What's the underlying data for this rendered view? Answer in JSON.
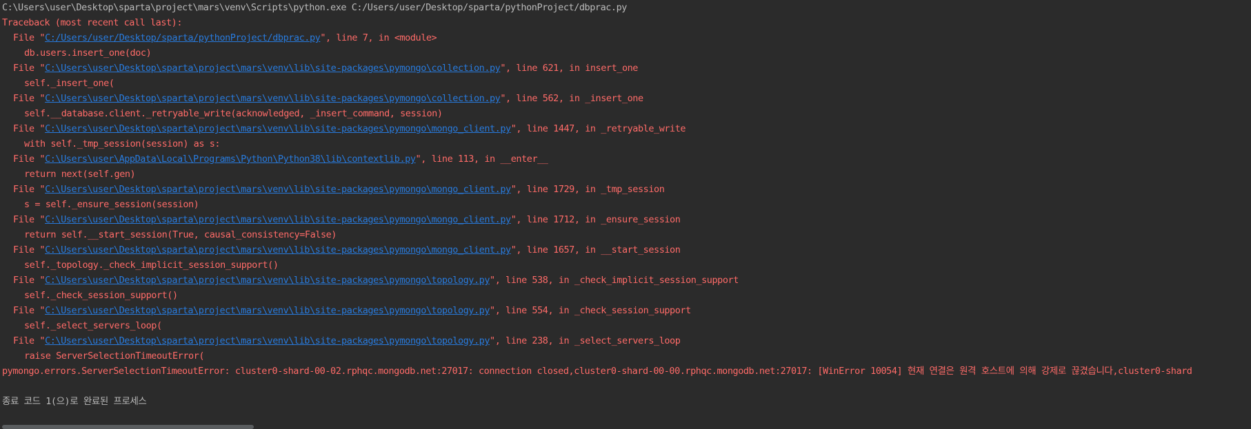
{
  "command_line": "C:\\Users\\user\\Desktop\\sparta\\project\\mars\\venv\\Scripts\\python.exe C:/Users/user/Desktop/sparta/pythonProject/dbprac.py",
  "traceback_header": "Traceback (most recent call last):",
  "frames": [
    {
      "prefix": "File \"",
      "path": "C:/Users/user/Desktop/sparta/pythonProject/dbprac.py",
      "suffix": "\", line 7, in <module>",
      "code": "db.users.insert_one(doc)"
    },
    {
      "prefix": "File \"",
      "path": "C:\\Users\\user\\Desktop\\sparta\\project\\mars\\venv\\lib\\site-packages\\pymongo\\collection.py",
      "suffix": "\", line 621, in insert_one",
      "code": "self._insert_one("
    },
    {
      "prefix": "File \"",
      "path": "C:\\Users\\user\\Desktop\\sparta\\project\\mars\\venv\\lib\\site-packages\\pymongo\\collection.py",
      "suffix": "\", line 562, in _insert_one",
      "code": "self.__database.client._retryable_write(acknowledged, _insert_command, session)"
    },
    {
      "prefix": "File \"",
      "path": "C:\\Users\\user\\Desktop\\sparta\\project\\mars\\venv\\lib\\site-packages\\pymongo\\mongo_client.py",
      "suffix": "\", line 1447, in _retryable_write",
      "code": "with self._tmp_session(session) as s:"
    },
    {
      "prefix": "File \"",
      "path": "C:\\Users\\user\\AppData\\Local\\Programs\\Python\\Python38\\lib\\contextlib.py",
      "suffix": "\", line 113, in __enter__",
      "code": "return next(self.gen)"
    },
    {
      "prefix": "File \"",
      "path": "C:\\Users\\user\\Desktop\\sparta\\project\\mars\\venv\\lib\\site-packages\\pymongo\\mongo_client.py",
      "suffix": "\", line 1729, in _tmp_session",
      "code": "s = self._ensure_session(session)"
    },
    {
      "prefix": "File \"",
      "path": "C:\\Users\\user\\Desktop\\sparta\\project\\mars\\venv\\lib\\site-packages\\pymongo\\mongo_client.py",
      "suffix": "\", line 1712, in _ensure_session",
      "code": "return self.__start_session(True, causal_consistency=False)"
    },
    {
      "prefix": "File \"",
      "path": "C:\\Users\\user\\Desktop\\sparta\\project\\mars\\venv\\lib\\site-packages\\pymongo\\mongo_client.py",
      "suffix": "\", line 1657, in __start_session",
      "code": "self._topology._check_implicit_session_support()"
    },
    {
      "prefix": "File \"",
      "path": "C:\\Users\\user\\Desktop\\sparta\\project\\mars\\venv\\lib\\site-packages\\pymongo\\topology.py",
      "suffix": "\", line 538, in _check_implicit_session_support",
      "code": "self._check_session_support()"
    },
    {
      "prefix": "File \"",
      "path": "C:\\Users\\user\\Desktop\\sparta\\project\\mars\\venv\\lib\\site-packages\\pymongo\\topology.py",
      "suffix": "\", line 554, in _check_session_support",
      "code": "self._select_servers_loop("
    },
    {
      "prefix": "File \"",
      "path": "C:\\Users\\user\\Desktop\\sparta\\project\\mars\\venv\\lib\\site-packages\\pymongo\\topology.py",
      "suffix": "\", line 238, in _select_servers_loop",
      "code": "raise ServerSelectionTimeoutError("
    }
  ],
  "error_message": "pymongo.errors.ServerSelectionTimeoutError: cluster0-shard-00-02.rphqc.mongodb.net:27017: connection closed,cluster0-shard-00-00.rphqc.mongodb.net:27017: [WinError 10054] 현재 연결은 원격 호스트에 의해 강제로 끊겼습니다,cluster0-shard",
  "exit_message": "종료 코드 1(으)로 완료된 프로세스",
  "colors": {
    "background": "#2b2b2b",
    "default_text": "#bbbbbb",
    "error_text": "#ff6b68",
    "link": "#287bde",
    "scrollbar_thumb": "#5a5d5f"
  }
}
